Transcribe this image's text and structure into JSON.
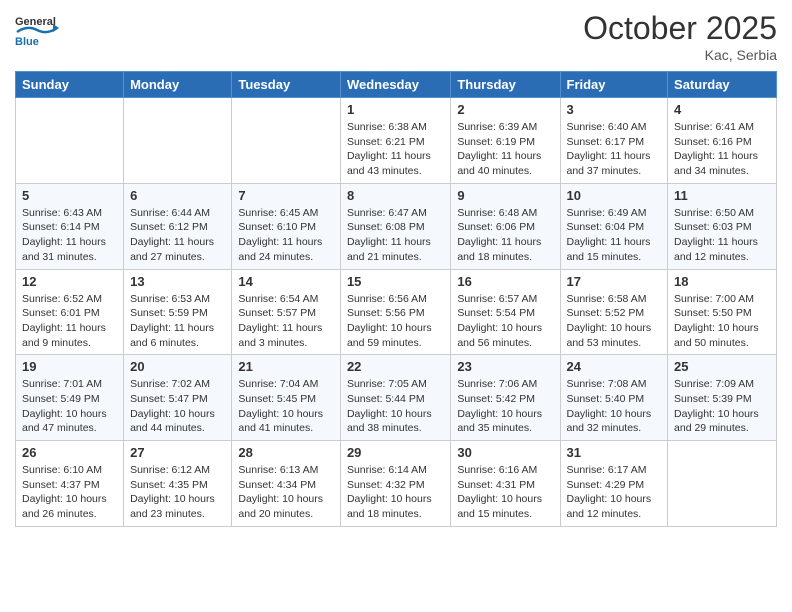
{
  "header": {
    "logo_general": "General",
    "logo_blue": "Blue",
    "month": "October 2025",
    "location": "Kac, Serbia"
  },
  "weekdays": [
    "Sunday",
    "Monday",
    "Tuesday",
    "Wednesday",
    "Thursday",
    "Friday",
    "Saturday"
  ],
  "weeks": [
    [
      {
        "day": "",
        "info": ""
      },
      {
        "day": "",
        "info": ""
      },
      {
        "day": "",
        "info": ""
      },
      {
        "day": "1",
        "info": "Sunrise: 6:38 AM\nSunset: 6:21 PM\nDaylight: 11 hours\nand 43 minutes."
      },
      {
        "day": "2",
        "info": "Sunrise: 6:39 AM\nSunset: 6:19 PM\nDaylight: 11 hours\nand 40 minutes."
      },
      {
        "day": "3",
        "info": "Sunrise: 6:40 AM\nSunset: 6:17 PM\nDaylight: 11 hours\nand 37 minutes."
      },
      {
        "day": "4",
        "info": "Sunrise: 6:41 AM\nSunset: 6:16 PM\nDaylight: 11 hours\nand 34 minutes."
      }
    ],
    [
      {
        "day": "5",
        "info": "Sunrise: 6:43 AM\nSunset: 6:14 PM\nDaylight: 11 hours\nand 31 minutes."
      },
      {
        "day": "6",
        "info": "Sunrise: 6:44 AM\nSunset: 6:12 PM\nDaylight: 11 hours\nand 27 minutes."
      },
      {
        "day": "7",
        "info": "Sunrise: 6:45 AM\nSunset: 6:10 PM\nDaylight: 11 hours\nand 24 minutes."
      },
      {
        "day": "8",
        "info": "Sunrise: 6:47 AM\nSunset: 6:08 PM\nDaylight: 11 hours\nand 21 minutes."
      },
      {
        "day": "9",
        "info": "Sunrise: 6:48 AM\nSunset: 6:06 PM\nDaylight: 11 hours\nand 18 minutes."
      },
      {
        "day": "10",
        "info": "Sunrise: 6:49 AM\nSunset: 6:04 PM\nDaylight: 11 hours\nand 15 minutes."
      },
      {
        "day": "11",
        "info": "Sunrise: 6:50 AM\nSunset: 6:03 PM\nDaylight: 11 hours\nand 12 minutes."
      }
    ],
    [
      {
        "day": "12",
        "info": "Sunrise: 6:52 AM\nSunset: 6:01 PM\nDaylight: 11 hours\nand 9 minutes."
      },
      {
        "day": "13",
        "info": "Sunrise: 6:53 AM\nSunset: 5:59 PM\nDaylight: 11 hours\nand 6 minutes."
      },
      {
        "day": "14",
        "info": "Sunrise: 6:54 AM\nSunset: 5:57 PM\nDaylight: 11 hours\nand 3 minutes."
      },
      {
        "day": "15",
        "info": "Sunrise: 6:56 AM\nSunset: 5:56 PM\nDaylight: 10 hours\nand 59 minutes."
      },
      {
        "day": "16",
        "info": "Sunrise: 6:57 AM\nSunset: 5:54 PM\nDaylight: 10 hours\nand 56 minutes."
      },
      {
        "day": "17",
        "info": "Sunrise: 6:58 AM\nSunset: 5:52 PM\nDaylight: 10 hours\nand 53 minutes."
      },
      {
        "day": "18",
        "info": "Sunrise: 7:00 AM\nSunset: 5:50 PM\nDaylight: 10 hours\nand 50 minutes."
      }
    ],
    [
      {
        "day": "19",
        "info": "Sunrise: 7:01 AM\nSunset: 5:49 PM\nDaylight: 10 hours\nand 47 minutes."
      },
      {
        "day": "20",
        "info": "Sunrise: 7:02 AM\nSunset: 5:47 PM\nDaylight: 10 hours\nand 44 minutes."
      },
      {
        "day": "21",
        "info": "Sunrise: 7:04 AM\nSunset: 5:45 PM\nDaylight: 10 hours\nand 41 minutes."
      },
      {
        "day": "22",
        "info": "Sunrise: 7:05 AM\nSunset: 5:44 PM\nDaylight: 10 hours\nand 38 minutes."
      },
      {
        "day": "23",
        "info": "Sunrise: 7:06 AM\nSunset: 5:42 PM\nDaylight: 10 hours\nand 35 minutes."
      },
      {
        "day": "24",
        "info": "Sunrise: 7:08 AM\nSunset: 5:40 PM\nDaylight: 10 hours\nand 32 minutes."
      },
      {
        "day": "25",
        "info": "Sunrise: 7:09 AM\nSunset: 5:39 PM\nDaylight: 10 hours\nand 29 minutes."
      }
    ],
    [
      {
        "day": "26",
        "info": "Sunrise: 6:10 AM\nSunset: 4:37 PM\nDaylight: 10 hours\nand 26 minutes."
      },
      {
        "day": "27",
        "info": "Sunrise: 6:12 AM\nSunset: 4:35 PM\nDaylight: 10 hours\nand 23 minutes."
      },
      {
        "day": "28",
        "info": "Sunrise: 6:13 AM\nSunset: 4:34 PM\nDaylight: 10 hours\nand 20 minutes."
      },
      {
        "day": "29",
        "info": "Sunrise: 6:14 AM\nSunset: 4:32 PM\nDaylight: 10 hours\nand 18 minutes."
      },
      {
        "day": "30",
        "info": "Sunrise: 6:16 AM\nSunset: 4:31 PM\nDaylight: 10 hours\nand 15 minutes."
      },
      {
        "day": "31",
        "info": "Sunrise: 6:17 AM\nSunset: 4:29 PM\nDaylight: 10 hours\nand 12 minutes."
      },
      {
        "day": "",
        "info": ""
      }
    ]
  ]
}
